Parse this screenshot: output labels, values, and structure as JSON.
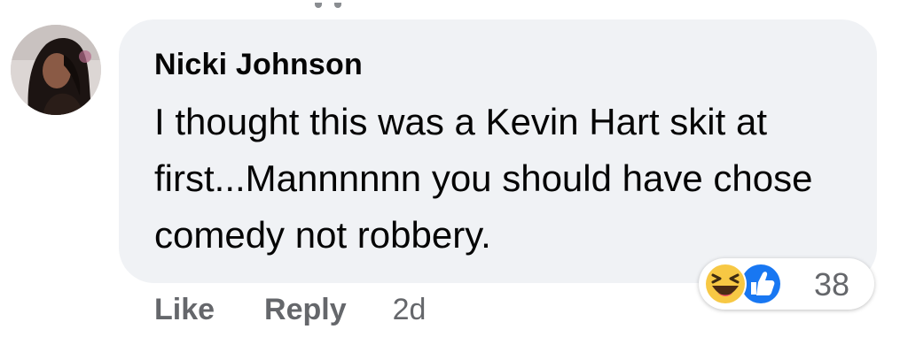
{
  "comment": {
    "author": "Nicki Johnson",
    "text": "I thought this was a Kevin Hart skit at first...Mannnnnn you should have chose comedy not robbery.",
    "timestamp": "2d"
  },
  "actions": {
    "like_label": "Like",
    "reply_label": "Reply"
  },
  "reactions": {
    "icons": [
      "haha-icon",
      "like-icon"
    ],
    "count": "38"
  },
  "colors": {
    "bubble_bg": "#f0f2f5",
    "meta_text": "#65676b",
    "like_blue": "#1877f2",
    "haha_yellow": "#f7c844"
  }
}
